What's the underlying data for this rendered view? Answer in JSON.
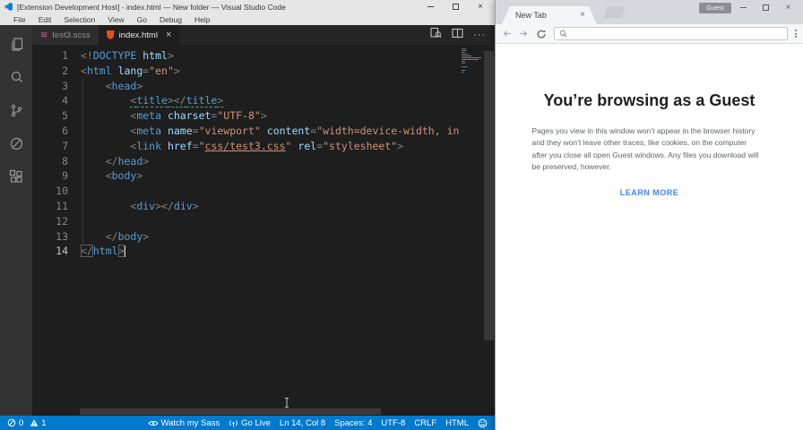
{
  "colors": {
    "statusbar": "#007acc",
    "activitybar": "#333333",
    "editor_bg": "#1e1e1e",
    "tag_blue": "#569cd6",
    "attr_blue": "#9cdcfe",
    "string_orange": "#ce9178",
    "sass_pink": "#cd6799",
    "html5_orange": "#e44d26",
    "link_blue": "#4285f4",
    "chrome_frame": "#d5d8dd"
  },
  "vscode": {
    "title": "[Extension Development Host] - index.html — New folder — Visual Studio Code",
    "menus": [
      "File",
      "Edit",
      "Selection",
      "View",
      "Go",
      "Debug",
      "Help"
    ],
    "activity_bar": [
      "files",
      "search",
      "source-control",
      "debug",
      "extensions"
    ],
    "tabs": [
      {
        "label": "test3.scss",
        "icon": "sass",
        "active": false
      },
      {
        "label": "index.html",
        "icon": "html5",
        "active": true
      }
    ],
    "editor": {
      "lines": [
        {
          "num": 1,
          "tokens": [
            [
              "p",
              "<!"
            ],
            [
              "t",
              "DOCTYPE"
            ],
            [
              "a",
              " html"
            ],
            [
              "p",
              ">"
            ]
          ]
        },
        {
          "num": 2,
          "tokens": [
            [
              "p",
              "<"
            ],
            [
              "t",
              "html"
            ],
            [
              "a",
              " lang"
            ],
            [
              "p",
              "="
            ],
            [
              "s",
              "\"en\""
            ],
            [
              "p",
              ">"
            ]
          ]
        },
        {
          "num": 3,
          "tokens": [
            [
              "d",
              "    "
            ],
            [
              "p",
              "<"
            ],
            [
              "t",
              "head"
            ],
            [
              "p",
              ">"
            ]
          ]
        },
        {
          "num": 4,
          "tokens": [
            [
              "d",
              "        "
            ],
            [
              "p w",
              "<"
            ],
            [
              "t w",
              "title"
            ],
            [
              "p w",
              "></"
            ],
            [
              "t w",
              "title"
            ],
            [
              "p w",
              ">"
            ]
          ]
        },
        {
          "num": 5,
          "tokens": [
            [
              "d",
              "        "
            ],
            [
              "p",
              "<"
            ],
            [
              "t",
              "meta"
            ],
            [
              "a",
              " charset"
            ],
            [
              "p",
              "="
            ],
            [
              "s",
              "\"UTF-8\""
            ],
            [
              "p",
              ">"
            ]
          ]
        },
        {
          "num": 6,
          "tokens": [
            [
              "d",
              "        "
            ],
            [
              "p",
              "<"
            ],
            [
              "t",
              "meta"
            ],
            [
              "a",
              " name"
            ],
            [
              "p",
              "="
            ],
            [
              "s",
              "\"viewport\""
            ],
            [
              "a",
              " content"
            ],
            [
              "p",
              "="
            ],
            [
              "s",
              "\"width=device-width, in"
            ]
          ]
        },
        {
          "num": 7,
          "tokens": [
            [
              "d",
              "        "
            ],
            [
              "p",
              "<"
            ],
            [
              "t",
              "link"
            ],
            [
              "a",
              " href"
            ],
            [
              "p",
              "="
            ],
            [
              "s",
              "\""
            ],
            [
              "s u",
              "css/test3.css"
            ],
            [
              "s",
              "\""
            ],
            [
              "a",
              " rel"
            ],
            [
              "p",
              "="
            ],
            [
              "s",
              "\"stylesheet\""
            ],
            [
              "p",
              ">"
            ]
          ]
        },
        {
          "num": 8,
          "tokens": [
            [
              "d",
              "    "
            ],
            [
              "p",
              "</"
            ],
            [
              "t",
              "head"
            ],
            [
              "p",
              ">"
            ]
          ]
        },
        {
          "num": 9,
          "tokens": [
            [
              "d",
              "    "
            ],
            [
              "p",
              "<"
            ],
            [
              "t",
              "body"
            ],
            [
              "p",
              ">"
            ]
          ]
        },
        {
          "num": 10,
          "tokens": []
        },
        {
          "num": 11,
          "tokens": [
            [
              "d",
              "        "
            ],
            [
              "p",
              "<"
            ],
            [
              "t",
              "div"
            ],
            [
              "p",
              "></"
            ],
            [
              "t",
              "div"
            ],
            [
              "p",
              ">"
            ]
          ]
        },
        {
          "num": 12,
          "tokens": []
        },
        {
          "num": 13,
          "tokens": [
            [
              "d",
              "    "
            ],
            [
              "p",
              "</"
            ],
            [
              "t",
              "body"
            ],
            [
              "p",
              ">"
            ]
          ]
        },
        {
          "num": 14,
          "current": true,
          "tokens": [
            [
              "p bx",
              "</"
            ],
            [
              "t",
              "html"
            ],
            [
              "p bx",
              ">"
            ],
            [
              "cursor",
              ""
            ]
          ]
        }
      ]
    },
    "status": {
      "errors": "0",
      "warnings": "1",
      "watch_sass": "Watch my Sass",
      "go_live": "Go Live",
      "cursor_pos": "Ln 14, Col 8",
      "spaces": "Spaces: 4",
      "encoding": "UTF-8",
      "eol": "CRLF",
      "language": "HTML"
    }
  },
  "browser": {
    "tab_title": "New Tab",
    "profile_badge": "Guest",
    "address_value": "",
    "page": {
      "heading": "You’re browsing as a Guest",
      "body_lines": [
        "Pages you view in this window won’t appear in the browser history",
        "and they won’t leave other traces, like cookies, on the computer",
        "after you close all open Guest windows. Any files you download will",
        "be preserved, however."
      ],
      "link": "LEARN MORE"
    }
  }
}
